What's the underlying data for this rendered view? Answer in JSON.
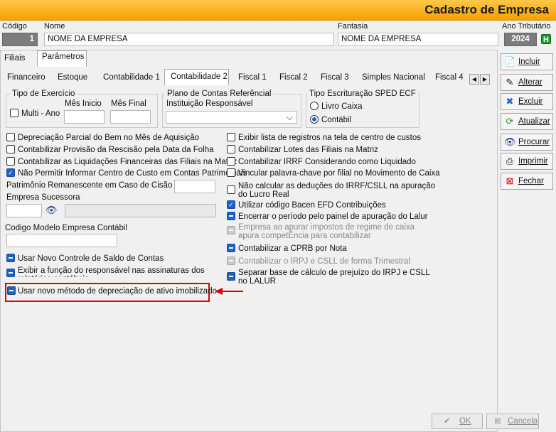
{
  "header": {
    "title": "Cadastro de Empresa"
  },
  "top": {
    "codigo_label": "Código",
    "codigo_value": "1",
    "nome_label": "Nome",
    "nome_value": "NOME DA EMPRESA",
    "fantasia_label": "Fantasia",
    "fantasia_value": "NOME DA EMPRESA",
    "ano_label": "Ano Tributário",
    "ano_value": "2024",
    "ano_button": "H"
  },
  "main_tabs": [
    "Filiais",
    "Parâmetros"
  ],
  "sub_tabs": [
    "Financeiro",
    "Estoque",
    "Contabilidade 1",
    "Contabilidade 2",
    "Fiscal 1",
    "Fiscal 2",
    "Fiscal 3",
    "Simples Nacional",
    "Fiscal 4"
  ],
  "exercicio": {
    "legend": "Tipo de Exercício",
    "multi_ano": "Multi - Ano",
    "mes_inicio": "Mês Inicio",
    "mes_final": "Mês Final"
  },
  "plano": {
    "legend": "Plano de Contas Referêncial",
    "instituicao": "Instituição Responsável"
  },
  "sped": {
    "legend": "Tipo Escrituração SPED ECF",
    "opt1": "Livro Caixa",
    "opt2": "Contábil"
  },
  "left_options": {
    "o1": "Depreciação Parcial do Bem no Mês de Aquisição",
    "o2": "Contabilizar Provisão da Rescisão pela Data da Folha",
    "o3": "Contabilizar as Liquidações Financeiras das Filiais na Matriz",
    "o4": "Não Permitir Informar Centro de Custo em Contas Patrimoniais",
    "patrimonio": "Patrimônio Remanescente em Caso de Cisão (%):",
    "sucessora": "Empresa Sucessora",
    "codigo_modelo": "Codigo Modelo Empresa Contábil",
    "o5": "Usar Novo Controle de Saldo de Contas",
    "o6": "Exibir a função do responsável nas assinaturas dos relatórios contábeis",
    "o7": "Usar novo método de depreciação de ativo imobilizado"
  },
  "right_options": {
    "r1": "Exibir lista de registros na tela de centro de custos",
    "r2": "Contabilizar Lotes das Filiais na Matriz",
    "r3": "Contabilizar IRRF Considerando como Liquidado",
    "r4": "Vincular palavra-chave por filial no Movimento de Caixa",
    "r5": "Não calcular as deduções do IRRF/CSLL na apuração do Lucro Real",
    "r6": "Utilizar código Bacen EFD Contribuições",
    "r7": "Encerrar o período pelo painel de apuração do Lalur",
    "r8": "Empresa ao apurar impostos de regime de caixa apura competÊncia para contabilizar",
    "r9": "Contabilizar a CPRB por Nota",
    "r10": "Contabilizar o IRPJ e CSLL de forma Trimestral",
    "r11": "Separar base de cálculo de prejuízo do IRPJ e CSLL no LALUR"
  },
  "side_buttons": [
    "Incluir",
    "Alterar",
    "Excluir",
    "Atualizar",
    "Procurar",
    "Imprimir",
    "Fechar"
  ],
  "bottom": {
    "ok": "OK",
    "cancela": "Cancela"
  },
  "colors": {
    "header": "#f5a000",
    "accent": "#1a64c8",
    "highlight": "#e00000"
  }
}
